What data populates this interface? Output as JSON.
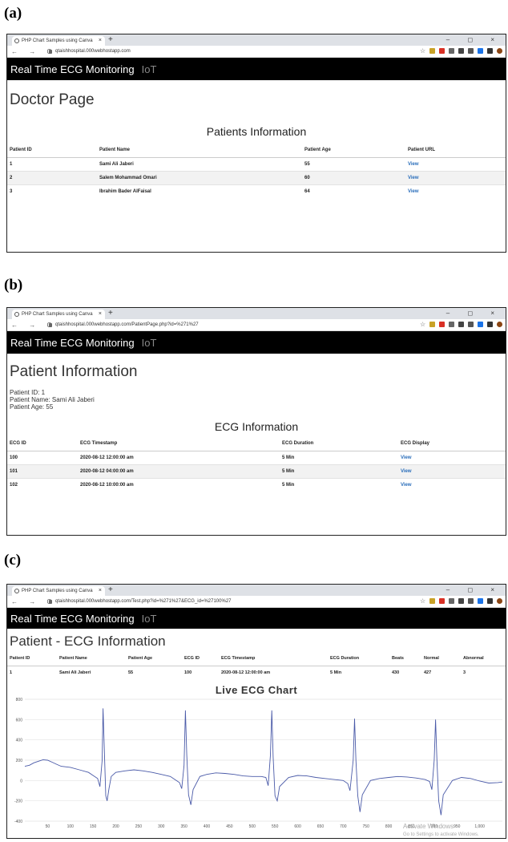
{
  "labels": {
    "a": "(a)",
    "b": "(b)",
    "c": "(c)"
  },
  "browser": {
    "tab_title": "PHP Chart Samples using Canva",
    "tab_close": "×",
    "new_tab": "+",
    "window_controls": "–  ◻  ×",
    "nav_buttons": "← → C",
    "star_icon": "☆"
  },
  "app": {
    "title": "Real Time ECG Monitoring",
    "subtitle": "IoT"
  },
  "panel_a": {
    "url": "qtaishhospital.000webhostapp.com",
    "page_title": "Doctor Page",
    "section_title": "Patients Information",
    "headers": [
      "Patient ID",
      "Patient Name",
      "Patient Age",
      "Patient URL"
    ],
    "rows": [
      [
        "1",
        "Sami Ali Jaberi",
        "55",
        "View"
      ],
      [
        "2",
        "Salem Mohammad Omari",
        "60",
        "View"
      ],
      [
        "3",
        "Ibrahim Bader AlFaisal",
        "64",
        "View"
      ]
    ]
  },
  "panel_b": {
    "url": "qtaishhospital.000webhostapp.com/PatientPage.php?id=%271%27",
    "page_title": "Patient Information",
    "patient_id": "Patient ID: 1",
    "patient_name": "Patient Name: Sami Ali Jaberi",
    "patient_age": "Patient Age: 55",
    "section_title": "ECG Information",
    "headers": [
      "ECG ID",
      "ECG Timestamp",
      "ECG Duration",
      "ECG Display"
    ],
    "rows": [
      [
        "100",
        "2020-08-12 12:00:00 am",
        "5 Min",
        "View"
      ],
      [
        "101",
        "2020-08-12 04:00:00 am",
        "5 Min",
        "View"
      ],
      [
        "102",
        "2020-08-12 10:00:00 am",
        "5 Min",
        "View"
      ]
    ]
  },
  "panel_c": {
    "url": "qtaishhospital.000webhostapp.com/Test.php?id=%271%27&ECG_id=%27100%27",
    "page_title": "Patient - ECG Information",
    "headers": [
      "Patient ID",
      "Patient Name",
      "Patient Age",
      "ECG ID",
      "ECG Timestamp",
      "ECG Duration",
      "Beats",
      "Normal",
      "Abnormal"
    ],
    "row": [
      "1",
      "Sami Ali Jaberi",
      "55",
      "100",
      "2020-08-12 12:00:00 am",
      "5 Min",
      "430",
      "427",
      "3"
    ],
    "activate_title": "Activate Windows",
    "activate_sub": "Go to Settings to activate Windows."
  },
  "chart_data": {
    "type": "line",
    "title": "Live ECG Chart",
    "xlabel": "",
    "ylabel": "",
    "xlim": [
      0,
      1050
    ],
    "ylim": [
      -400,
      800
    ],
    "y_ticks": [
      -400,
      -200,
      0,
      200,
      400,
      600,
      800
    ],
    "x_ticks": [
      50,
      100,
      150,
      200,
      250,
      300,
      350,
      400,
      450,
      500,
      550,
      600,
      650,
      700,
      750,
      800,
      850,
      900,
      950,
      1000
    ],
    "x_tick_labels": [
      "50",
      "100",
      "150",
      "200",
      "250",
      "300",
      "350",
      "400",
      "450",
      "500",
      "550",
      "600",
      "650",
      "700",
      "750",
      "800",
      "850",
      "900",
      "950",
      "1,000"
    ],
    "grid": true,
    "color": "#4a5aa8",
    "series": [
      {
        "x": [
          0,
          10,
          20,
          30,
          40,
          50,
          60,
          70,
          80,
          100,
          120,
          140,
          150,
          160,
          165,
          170,
          172,
          175,
          178,
          181,
          185,
          190,
          200,
          220,
          240,
          260,
          280,
          300,
          320,
          330,
          340,
          345,
          350,
          353,
          356,
          360,
          365,
          370,
          385,
          400,
          420,
          440,
          460,
          480,
          500,
          520,
          530,
          535,
          540,
          543,
          546,
          550,
          555,
          560,
          580,
          600,
          620,
          640,
          660,
          680,
          700,
          710,
          715,
          722,
          725,
          728,
          732,
          737,
          742,
          760,
          780,
          800,
          820,
          840,
          860,
          880,
          890,
          895,
          900,
          903,
          906,
          910,
          915,
          920,
          940,
          960,
          980,
          1000,
          1020,
          1040,
          1050
        ],
        "y": [
          140,
          150,
          175,
          190,
          205,
          200,
          180,
          160,
          140,
          130,
          105,
          80,
          50,
          20,
          -60,
          200,
          710,
          280,
          -150,
          -200,
          -80,
          40,
          80,
          95,
          105,
          95,
          80,
          60,
          40,
          10,
          -20,
          -80,
          150,
          690,
          250,
          -140,
          -240,
          -90,
          40,
          60,
          75,
          70,
          60,
          45,
          40,
          40,
          30,
          -50,
          250,
          690,
          230,
          -150,
          -200,
          -60,
          30,
          50,
          45,
          30,
          20,
          10,
          0,
          -30,
          -100,
          200,
          610,
          200,
          -150,
          -310,
          -140,
          0,
          20,
          30,
          40,
          35,
          25,
          10,
          -10,
          -90,
          200,
          600,
          200,
          -200,
          -340,
          -140,
          0,
          30,
          20,
          -5,
          -25,
          -20,
          -15
        ]
      }
    ]
  }
}
